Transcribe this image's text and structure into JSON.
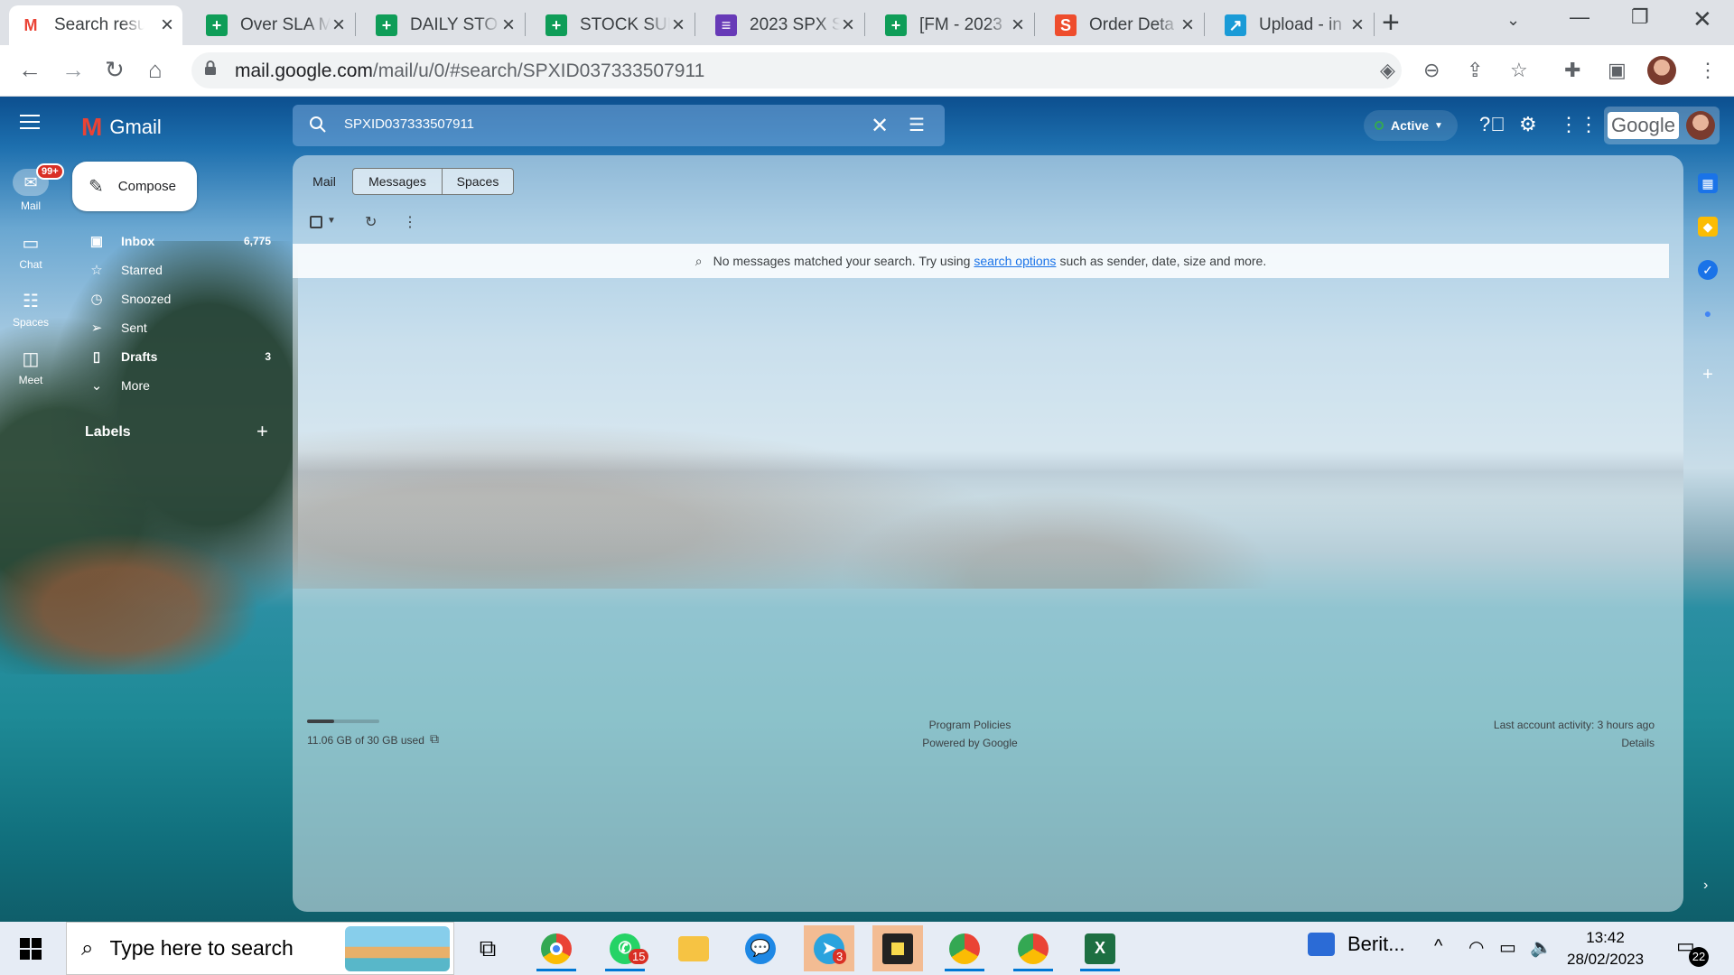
{
  "browser": {
    "tabs": [
      {
        "title": "Search resu",
        "favicon": "gmail-icon",
        "color": "#ea4335",
        "active": true
      },
      {
        "title": "Over SLA M",
        "favicon": "sheets-icon",
        "color": "#0f9d58"
      },
      {
        "title": "DAILY STO",
        "favicon": "sheets-icon",
        "color": "#0f9d58"
      },
      {
        "title": "STOCK SUP",
        "favicon": "sheets-icon",
        "color": "#0f9d58"
      },
      {
        "title": "2023 SPX S",
        "favicon": "forms-icon",
        "color": "#673ab7"
      },
      {
        "title": "[FM - 2023",
        "favicon": "sheets-icon",
        "color": "#0f9d58"
      },
      {
        "title": "Order Deta",
        "favicon": "shopee-icon",
        "color": "#ee4d2d"
      },
      {
        "title": "Upload - in",
        "favicon": "upload-icon",
        "color": "#1a9bd7"
      }
    ],
    "url_host": "mail.google.com",
    "url_path": "/mail/u/0/#search/SPXID037333507911"
  },
  "gmail": {
    "app_name": "Gmail",
    "search_query": "SPXID037333507911",
    "status": "Active",
    "google_word": "Google",
    "compose_label": "Compose",
    "rail": [
      {
        "label": "Mail",
        "badge": "99+"
      },
      {
        "label": "Chat"
      },
      {
        "label": "Spaces"
      },
      {
        "label": "Meet"
      }
    ],
    "nav": [
      {
        "label": "Inbox",
        "count": "6,775",
        "icon": "inbox-icon",
        "bold": true
      },
      {
        "label": "Starred",
        "count": "",
        "icon": "star-icon"
      },
      {
        "label": "Snoozed",
        "count": "",
        "icon": "clock-icon"
      },
      {
        "label": "Sent",
        "count": "",
        "icon": "send-icon"
      },
      {
        "label": "Drafts",
        "count": "3",
        "icon": "draft-icon",
        "bold": true
      },
      {
        "label": "More",
        "count": "",
        "icon": "chevron-down-icon"
      }
    ],
    "labels_header": "Labels",
    "type_tabs": [
      "Mail",
      "Messages",
      "Spaces"
    ],
    "no_results": {
      "prefix": "No messages matched your search. Try using",
      "link": "search options",
      "suffix": "such as sender, date, size and more."
    },
    "storage": {
      "text": "11.06 GB of 30 GB used",
      "fraction": 0.369
    },
    "footer": {
      "program_policies": "Program Policies",
      "powered_by": "Powered by Google",
      "last_activity": "Last account activity: 3 hours ago",
      "details": "Details"
    }
  },
  "taskbar": {
    "search_placeholder": "Type here to search",
    "whatsapp_badge": "15",
    "telegram_badge": "3",
    "news_label": "Berit...",
    "time": "13:42",
    "date": "28/02/2023",
    "notifications": "22"
  }
}
